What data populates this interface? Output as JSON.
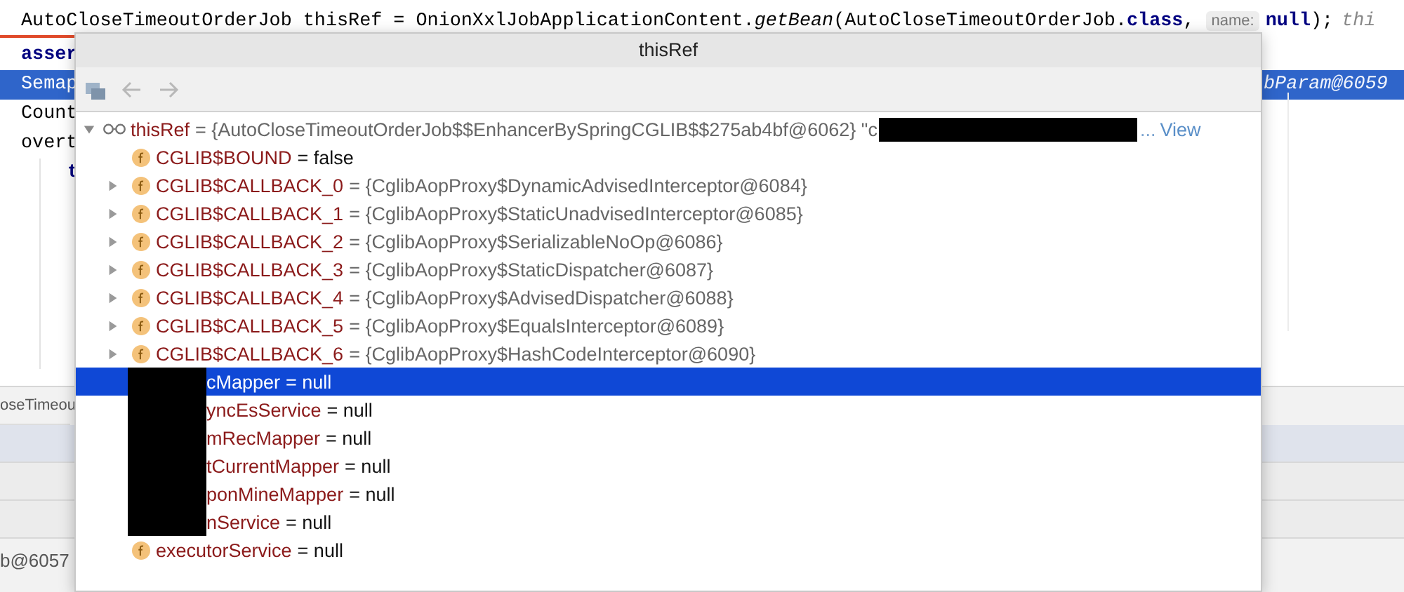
{
  "editor": {
    "lines": [
      {
        "selected": false,
        "indent": false,
        "segments": [
          {
            "kind": "plain",
            "text": "AutoCloseTimeoutOrderJob thisRef = OnionXxlJobApplicationContent."
          },
          {
            "kind": "italic",
            "text": "getBean"
          },
          {
            "kind": "plain",
            "text": "(AutoCloseTimeoutOrderJob."
          },
          {
            "kind": "keyword",
            "text": "class"
          },
          {
            "kind": "plain",
            "text": ", "
          },
          {
            "kind": "hint",
            "text": "name:"
          },
          {
            "kind": "keyword",
            "text": "null"
          },
          {
            "kind": "plain",
            "text": ");"
          },
          {
            "kind": "comment",
            "text": "thi"
          }
        ]
      },
      {
        "selected": false,
        "indent": false,
        "segments": [
          {
            "kind": "keyword",
            "text": "asser"
          }
        ]
      },
      {
        "selected": true,
        "indent": false,
        "segments": [
          {
            "kind": "plain",
            "text": "Semap"
          }
        ],
        "inline_value": "bParam@6059"
      },
      {
        "selected": false,
        "indent": false,
        "segments": [
          {
            "kind": "plain",
            "text": "Count"
          }
        ]
      },
      {
        "selected": false,
        "indent": false,
        "segments": [
          {
            "kind": "plain",
            "text": "overt"
          }
        ]
      },
      {
        "selected": false,
        "indent": true,
        "segments": [
          {
            "kind": "keyword",
            "text": "t"
          }
        ]
      }
    ]
  },
  "bottom_panel": {
    "tab": "oseTimeou",
    "frames": [
      {
        "selected": true
      },
      {
        "selected": false
      },
      {
        "selected": false
      }
    ],
    "item": "b@6057"
  },
  "popup": {
    "title": "thisRef",
    "toolbar": [
      {
        "kind": "group",
        "disabled": false
      },
      {
        "kind": "back",
        "disabled": true
      },
      {
        "kind": "forward",
        "disabled": true
      }
    ],
    "root": {
      "name": "thisRef",
      "value": "= {AutoCloseTimeoutOrderJob$$EnhancerBySpringCGLIB$$275ab4bf@6062} \"c",
      "redacted": true,
      "ellipsis": "...",
      "link": "View",
      "expanded": true
    },
    "children": [
      {
        "name": "CGLIB$BOUND",
        "value": "= false",
        "kind": "primitive",
        "expandable": false,
        "redacted": false,
        "selected": false
      },
      {
        "name": "CGLIB$CALLBACK_0",
        "value": "= {CglibAopProxy$DynamicAdvisedInterceptor@6084}",
        "kind": "object",
        "expandable": true,
        "redacted": false,
        "selected": false
      },
      {
        "name": "CGLIB$CALLBACK_1",
        "value": "= {CglibAopProxy$StaticUnadvisedInterceptor@6085}",
        "kind": "object",
        "expandable": true,
        "redacted": false,
        "selected": false
      },
      {
        "name": "CGLIB$CALLBACK_2",
        "value": "= {CglibAopProxy$SerializableNoOp@6086}",
        "kind": "object",
        "expandable": true,
        "redacted": false,
        "selected": false
      },
      {
        "name": "CGLIB$CALLBACK_3",
        "value": "= {CglibAopProxy$StaticDispatcher@6087}",
        "kind": "object",
        "expandable": true,
        "redacted": false,
        "selected": false
      },
      {
        "name": "CGLIB$CALLBACK_4",
        "value": "= {CglibAopProxy$AdvisedDispatcher@6088}",
        "kind": "object",
        "expandable": true,
        "redacted": false,
        "selected": false
      },
      {
        "name": "CGLIB$CALLBACK_5",
        "value": "= {CglibAopProxy$EqualsInterceptor@6089}",
        "kind": "object",
        "expandable": true,
        "redacted": false,
        "selected": false
      },
      {
        "name": "CGLIB$CALLBACK_6",
        "value": "= {CglibAopProxy$HashCodeInterceptor@6090}",
        "kind": "object",
        "expandable": true,
        "redacted": false,
        "selected": false
      },
      {
        "name": "cMapper",
        "value": "= null",
        "kind": "primitive",
        "expandable": false,
        "redacted": true,
        "selected": true
      },
      {
        "name": "yncEsService",
        "value": "= null",
        "kind": "primitive",
        "expandable": false,
        "redacted": true,
        "selected": false
      },
      {
        "name": "mRecMapper",
        "value": "= null",
        "kind": "primitive",
        "expandable": false,
        "redacted": true,
        "selected": false
      },
      {
        "name": "tCurrentMapper",
        "value": "= null",
        "kind": "primitive",
        "expandable": false,
        "redacted": true,
        "selected": false
      },
      {
        "name": "ponMineMapper",
        "value": "= null",
        "kind": "primitive",
        "expandable": false,
        "redacted": true,
        "selected": false
      },
      {
        "name": "nService",
        "value": "= null",
        "kind": "primitive",
        "expandable": false,
        "redacted": true,
        "selected": false
      },
      {
        "name": "executorService",
        "value": "= null",
        "kind": "primitive",
        "expandable": false,
        "redacted": false,
        "selected": false
      }
    ]
  }
}
